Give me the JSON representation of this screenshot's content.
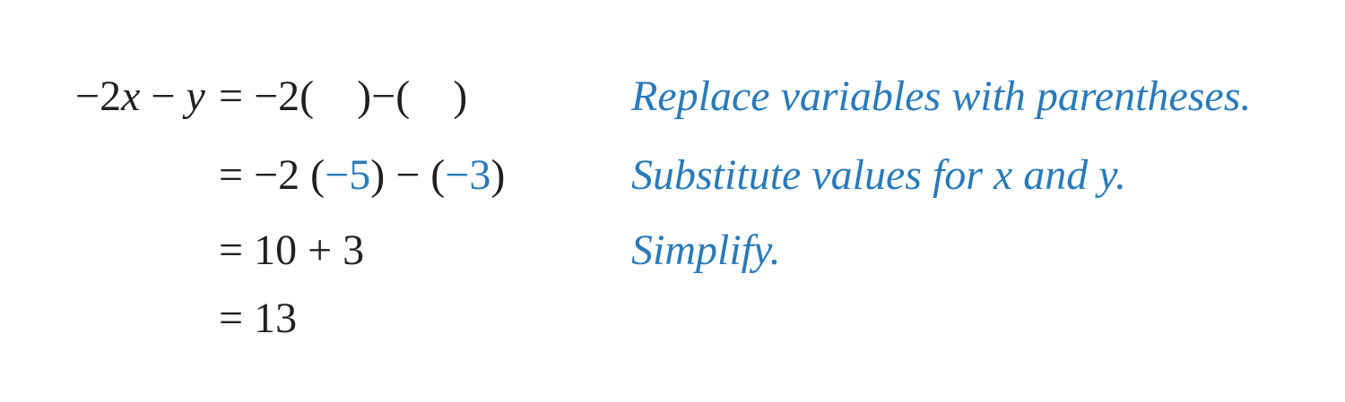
{
  "steps": [
    {
      "lhs": {
        "coef": "−2",
        "var_x": "x",
        "minus": " − ",
        "var_y": "y"
      },
      "rhs": {
        "eq": "=",
        "a": " −2( ",
        "gap1": "   ",
        "b": ")−( ",
        "gap2": "   ",
        "c": ")"
      },
      "note": "Replace variables with parentheses."
    },
    {
      "rhs": {
        "eq": "=",
        "a": " −2 (",
        "x_val": "−5",
        "b": ") − (",
        "y_val": "−3",
        "c": ")"
      },
      "note_parts": {
        "pre": "Substitute values for ",
        "x": "x",
        "mid": " and ",
        "y": "y",
        "post": "."
      }
    },
    {
      "rhs": {
        "text": "= 10 + 3"
      },
      "note": "Simplify."
    },
    {
      "rhs": {
        "text": "= 13"
      }
    }
  ]
}
